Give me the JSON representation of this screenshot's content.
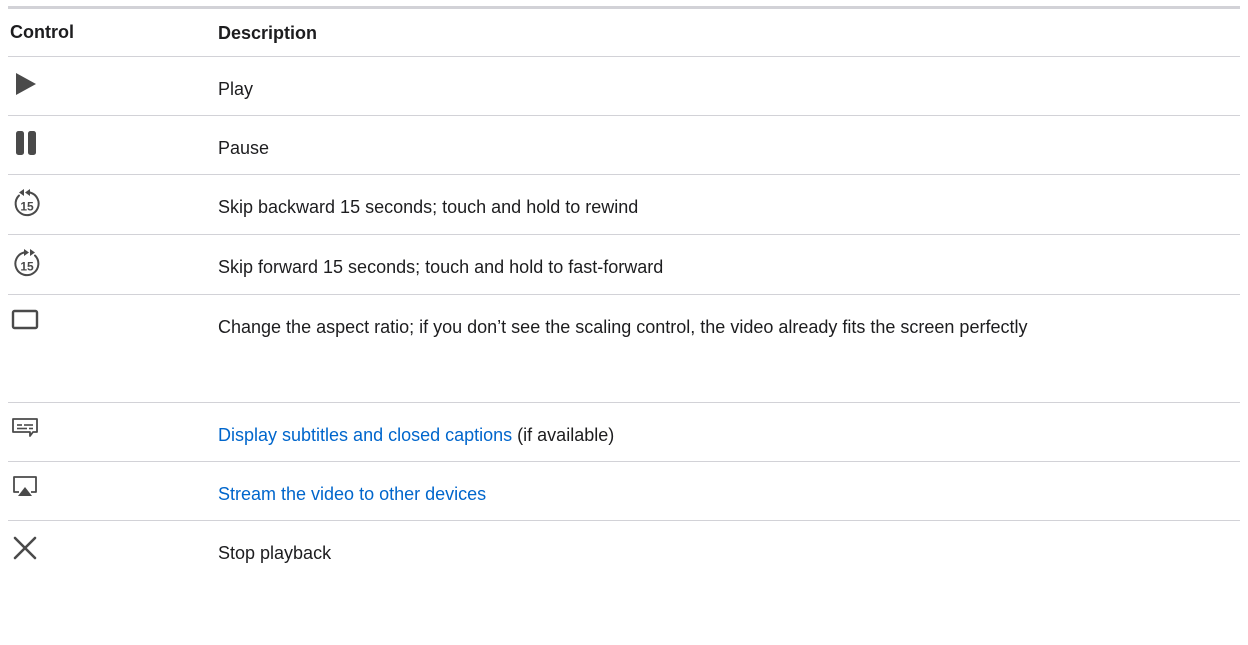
{
  "table": {
    "headers": {
      "control": "Control",
      "description": "Description"
    },
    "rows": [
      {
        "icon": "play-icon",
        "description": "Play"
      },
      {
        "icon": "pause-icon",
        "description": "Pause"
      },
      {
        "icon": "skip-back-15-icon",
        "icon_label": "15",
        "description": "Skip backward 15 seconds; touch and hold to rewind"
      },
      {
        "icon": "skip-forward-15-icon",
        "icon_label": "15",
        "description": "Skip forward 15 seconds; touch and hold to fast-forward"
      },
      {
        "icon": "aspect-ratio-icon",
        "description": "Change the aspect ratio; if you don’t see the scaling control, the video already fits the screen perfectly"
      },
      {
        "icon": "subtitles-icon",
        "link_text": "Display subtitles and closed captions",
        "description": " (if available)"
      },
      {
        "icon": "airplay-icon",
        "link_text": "Stream the video to other devices"
      },
      {
        "icon": "close-icon",
        "description": "Stop playback"
      }
    ]
  },
  "colors": {
    "text": "#1d1d1f",
    "link": "#0066cc",
    "icon": "#4a4a4a",
    "divider": "#d2d2d7"
  }
}
